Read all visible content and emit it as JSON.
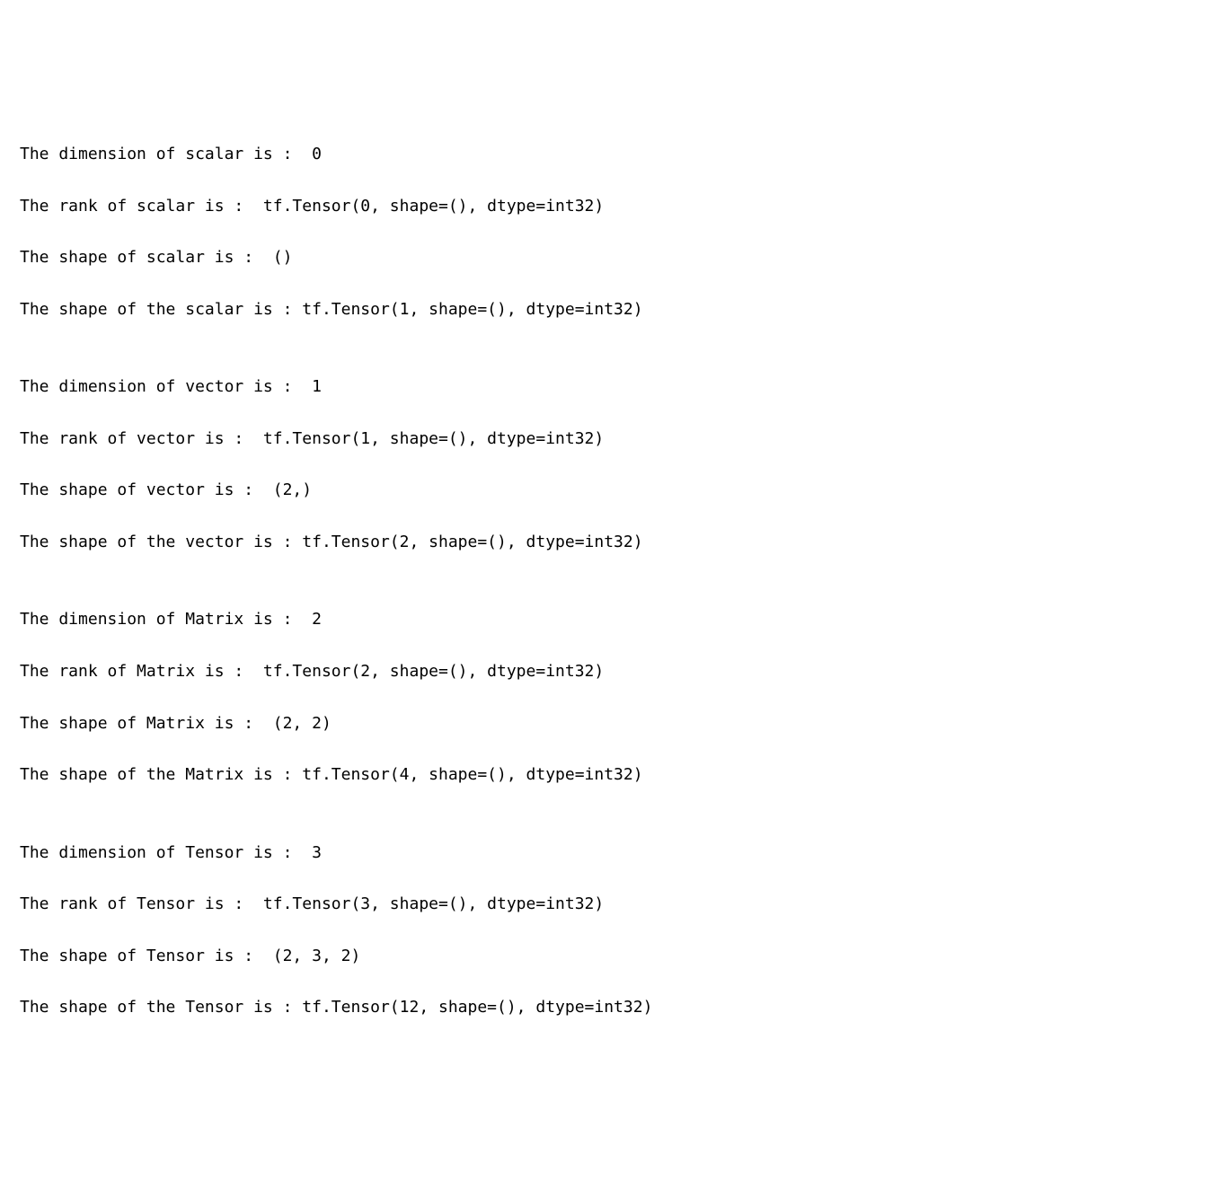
{
  "lines": [
    "The dimension of scalar is :  0",
    "The rank of scalar is :  tf.Tensor(0, shape=(), dtype=int32)",
    "The shape of scalar is :  ()",
    "The shape of the scalar is : tf.Tensor(1, shape=(), dtype=int32)",
    "",
    "The dimension of vector is :  1",
    "The rank of vector is :  tf.Tensor(1, shape=(), dtype=int32)",
    "The shape of vector is :  (2,)",
    "The shape of the vector is : tf.Tensor(2, shape=(), dtype=int32)",
    "",
    "The dimension of Matrix is :  2",
    "The rank of Matrix is :  tf.Tensor(2, shape=(), dtype=int32)",
    "The shape of Matrix is :  (2, 2)",
    "The shape of the Matrix is : tf.Tensor(4, shape=(), dtype=int32)",
    "",
    "The dimension of Tensor is :  3",
    "The rank of Tensor is :  tf.Tensor(3, shape=(), dtype=int32)",
    "The shape of Tensor is :  (2, 3, 2)",
    "The shape of the Tensor is : tf.Tensor(12, shape=(), dtype=int32)"
  ]
}
